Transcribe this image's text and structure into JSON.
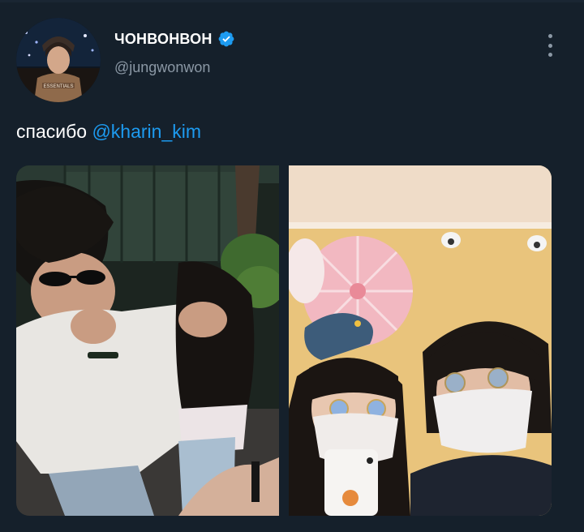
{
  "user": {
    "display_name": "ЧОНВОНВОН",
    "handle": "@jungwonwon",
    "verified": true,
    "avatar_shirt_text": "ESSENTIALS"
  },
  "tweet": {
    "text_before_mention": "спасибо ",
    "mention": "@kharin_kim"
  },
  "media": {
    "photos": [
      {
        "name": "photo-1"
      },
      {
        "name": "photo-2"
      }
    ]
  },
  "icons": {
    "verified": "verified-badge-icon",
    "more": "more-vertical-icon"
  },
  "colors": {
    "background": "#15202b",
    "text": "#ffffff",
    "secondary_text": "#8b98a5",
    "accent": "#1d9bf0"
  }
}
